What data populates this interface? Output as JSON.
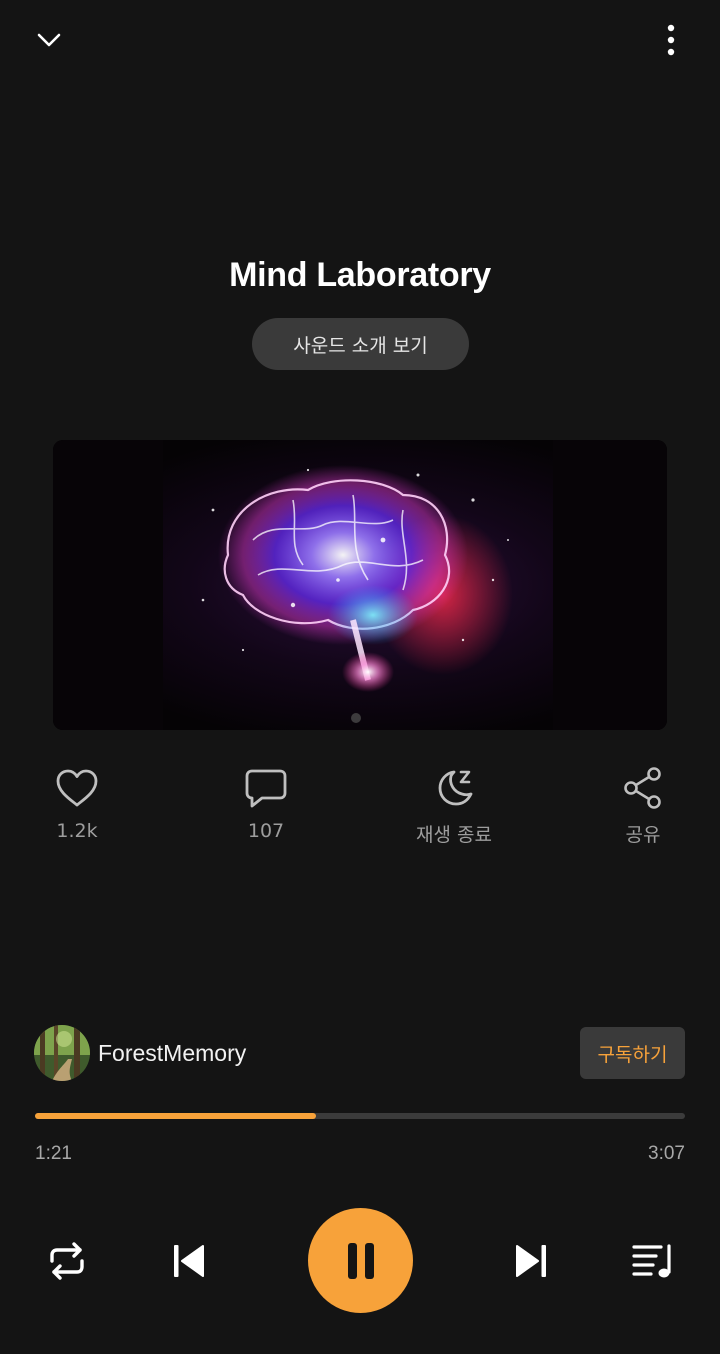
{
  "header": {
    "collapse_icon": "chevron-down-icon",
    "menu_icon": "more-vertical-icon"
  },
  "track": {
    "title": "Mind Laboratory",
    "intro_button": "사운드 소개 보기"
  },
  "actions": {
    "like": {
      "icon": "heart-icon",
      "label": "1.2k"
    },
    "comment": {
      "icon": "comment-icon",
      "label": "107"
    },
    "sleep_timer": {
      "icon": "moon-sleep-icon",
      "label": "재생 종료"
    },
    "share": {
      "icon": "share-icon",
      "label": "공유"
    }
  },
  "creator": {
    "name": "ForestMemory",
    "subscribe_label": "구독하기"
  },
  "playback": {
    "current_time": "1:21",
    "duration": "3:07",
    "progress": 0.433
  },
  "controls": {
    "repeat_icon": "repeat-icon",
    "prev_icon": "skip-previous-icon",
    "pause_icon": "pause-icon",
    "next_icon": "skip-next-icon",
    "queue_icon": "playlist-icon"
  },
  "colors": {
    "accent": "#f7a23a",
    "background": "#141414",
    "chip": "#3a3a3a"
  }
}
